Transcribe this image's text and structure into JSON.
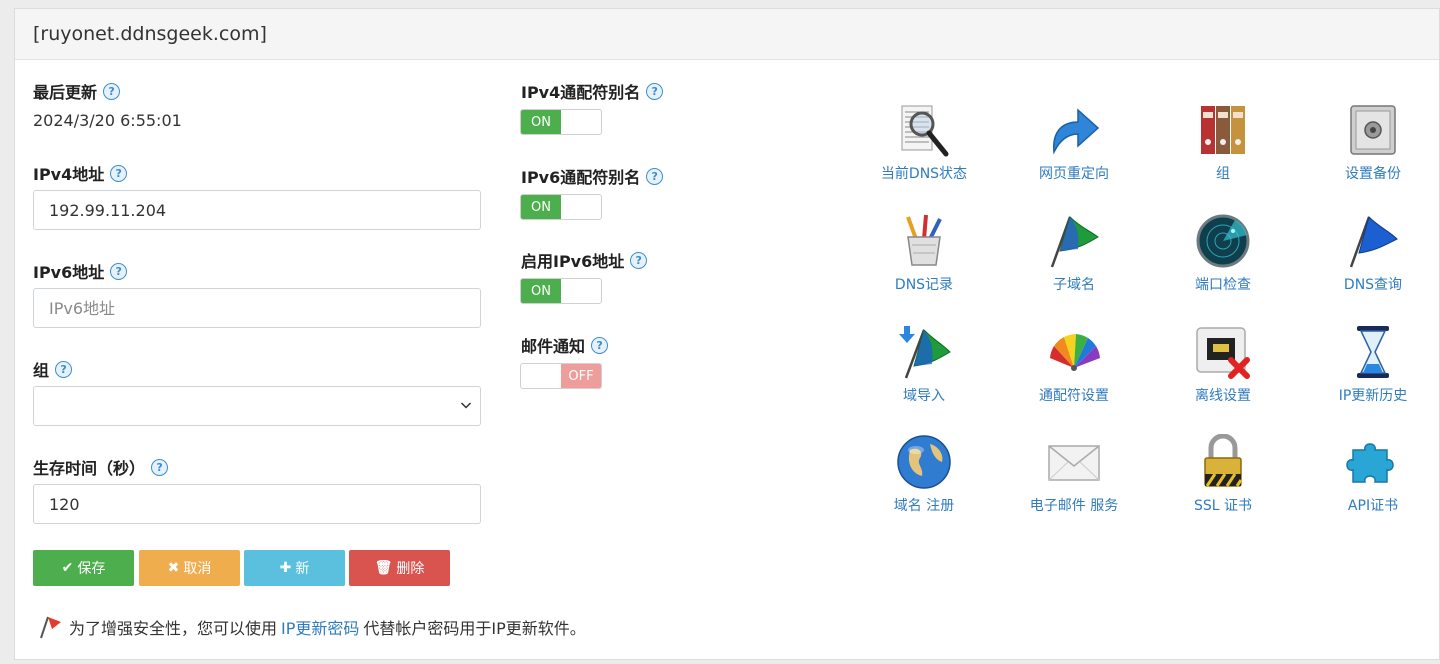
{
  "header": {
    "title": "[ruyonet.ddnsgeek.com]"
  },
  "form": {
    "last_update": {
      "label": "最后更新",
      "value": "2024/3/20 6:55:01"
    },
    "ipv4": {
      "label": "IPv4地址",
      "value": "192.99.11.204"
    },
    "ipv6": {
      "label": "IPv6地址",
      "value": "",
      "placeholder": "IPv6地址"
    },
    "group": {
      "label": "组",
      "value": ""
    },
    "ttl": {
      "label": "生存时间（秒）",
      "value": "120"
    }
  },
  "toggles": [
    {
      "label": "IPv4通配符别名",
      "state": "ON"
    },
    {
      "label": "IPv6通配符别名",
      "state": "ON"
    },
    {
      "label": "启用IPv6地址",
      "state": "ON"
    },
    {
      "label": "邮件通知",
      "state": "OFF"
    }
  ],
  "help_glyph": "?",
  "buttons": {
    "save": {
      "label": "保存",
      "glyph": "✔",
      "color": "#4cae4c"
    },
    "cancel": {
      "label": "取消",
      "glyph": "✖",
      "color": "#f0ad4e"
    },
    "new": {
      "label": "新",
      "glyph": "✚",
      "color": "#5bc0de"
    },
    "delete": {
      "label": "删除",
      "glyph": "🗑",
      "color": "#d9534f"
    }
  },
  "tools": [
    {
      "label": "当前DNS状态",
      "icon": "dns-status-magnifier-icon"
    },
    {
      "label": "网页重定向",
      "icon": "redirect-arrow-icon"
    },
    {
      "label": "组",
      "icon": "binders-icon"
    },
    {
      "label": "设置备份",
      "icon": "safe-icon"
    },
    {
      "label": "DNS记录",
      "icon": "pencil-cup-icon"
    },
    {
      "label": "子域名",
      "icon": "green-flag-icon"
    },
    {
      "label": "端口检查",
      "icon": "radar-icon"
    },
    {
      "label": "DNS查询",
      "icon": "blue-flag-icon"
    },
    {
      "label": "域导入",
      "icon": "flag-import-icon"
    },
    {
      "label": "通配符设置",
      "icon": "color-fan-icon"
    },
    {
      "label": "离线设置",
      "icon": "network-port-offline-icon"
    },
    {
      "label": "IP更新历史",
      "icon": "hourglass-icon"
    },
    {
      "label": "域名 注册",
      "icon": "globe-icon"
    },
    {
      "label": "电子邮件 服务",
      "icon": "envelope-icon"
    },
    {
      "label": "SSL 证书",
      "icon": "padlock-icon"
    },
    {
      "label": "API证书",
      "icon": "puzzle-icon"
    }
  ],
  "notice": {
    "prefix": "为了增强安全性，您可以使用",
    "link": "IP更新密码",
    "suffix": "代替帐户密码用于IP更新软件。"
  }
}
